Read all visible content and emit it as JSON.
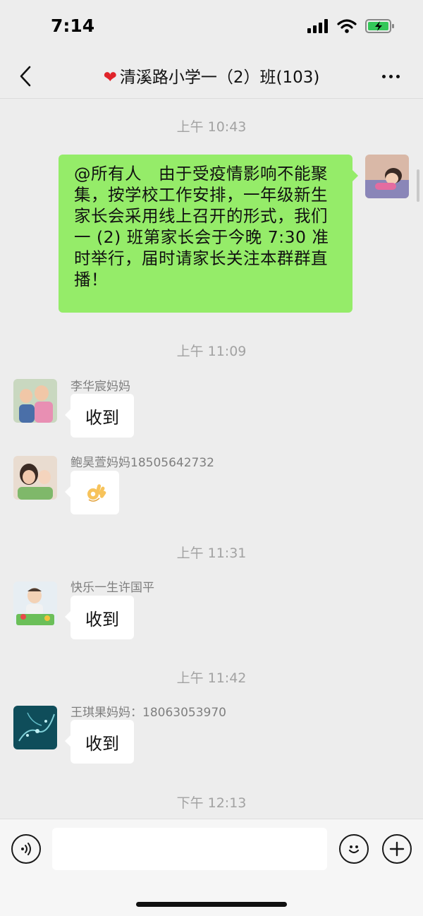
{
  "status_bar": {
    "time": "7:14"
  },
  "header": {
    "title": "清溪路小学一（2）班(103)"
  },
  "messages": [
    {
      "timestamp": "上午 10:43"
    },
    {
      "text": "@所有人　由于受疫情影响不能聚集，按学校工作安排，一年级新生家长会采用线上召开的形式，我们一 (2) 班第家长会于今晚 7:30 准时举行，届时请家长关注本群群直播！"
    },
    {
      "timestamp": "上午 11:09"
    },
    {
      "sender": "李华宸妈妈",
      "text": "收到"
    },
    {
      "sender": "鲍昊萱妈妈18505642732",
      "emoji": "ok-hand"
    },
    {
      "timestamp": "上午 11:31"
    },
    {
      "sender": "快乐一生许国平",
      "text": "收到"
    },
    {
      "timestamp": "上午 11:42"
    },
    {
      "sender": "王琪果妈妈：18063053970",
      "text": "收到"
    },
    {
      "timestamp": "下午 12:13"
    }
  ],
  "colors": {
    "outgoing_bubble": "#95ec69",
    "incoming_bubble": "#ffffff",
    "background": "#ededed"
  },
  "icons": [
    "chevron-left-icon",
    "more-icon",
    "voice-icon",
    "emoji-icon",
    "plus-icon",
    "signal-icon",
    "wifi-icon",
    "battery-icon"
  ]
}
